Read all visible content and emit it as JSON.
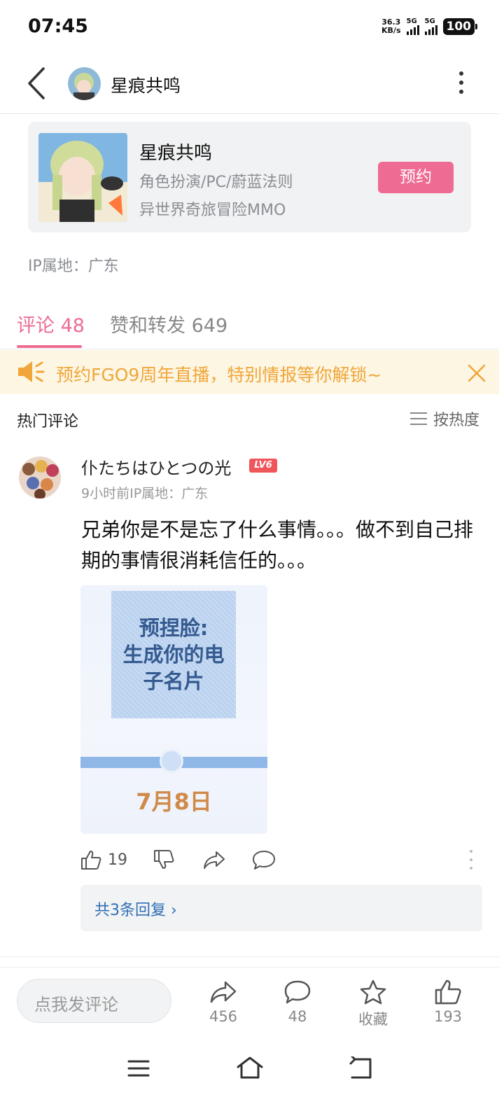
{
  "status_bar": {
    "time": "07:45",
    "net_speed_value": "36.3",
    "net_speed_unit": "KB/s",
    "signal1_label": "5G",
    "signal2_label": "5G",
    "battery": "100"
  },
  "header": {
    "title": "星痕共鸣",
    "icons": [
      "back-arrow-icon",
      "avatar",
      "more-vertical-icon"
    ]
  },
  "game_card": {
    "name": "星痕共鸣",
    "tags": "角色扮演/PC/蔚蓝法则",
    "subtitle": "异世界奇旅冒险MMO",
    "reserve_label": "预约"
  },
  "ip_location": "IP属地：广东",
  "tabs": [
    {
      "label": "评论 48",
      "active": true
    },
    {
      "label": "赞和转发 649",
      "active": false
    }
  ],
  "notice": {
    "text": "预约FGO9周年直播，特别情报等你解锁~",
    "icons": [
      "speaker-icon",
      "close-icon"
    ]
  },
  "comments_header": {
    "title": "热门评论",
    "sort_label": "按热度"
  },
  "comment": {
    "username": "仆たちはひとつの光",
    "level_badge": "LV6",
    "meta": "9小时前IP属地：广东",
    "text": "兄弟你是不是忘了什么事情。。。做不到自己排期的事情很消耗信任的。。。",
    "image_text": "预捏脸:\n生成你的电\n子名片",
    "image_date": "7月8日",
    "like_count": "19",
    "replies_label": "共3条回复 ›"
  },
  "bottom_bar": {
    "input_placeholder": "点我发评论",
    "share_count": "456",
    "comment_count": "48",
    "favorite_label": "收藏",
    "like_count": "193"
  },
  "colors": {
    "accent_pink": "#ee6c93",
    "notice_orange": "#f0a63a",
    "notice_bg": "#fdf6e3",
    "link_blue": "#2f6fb5"
  }
}
